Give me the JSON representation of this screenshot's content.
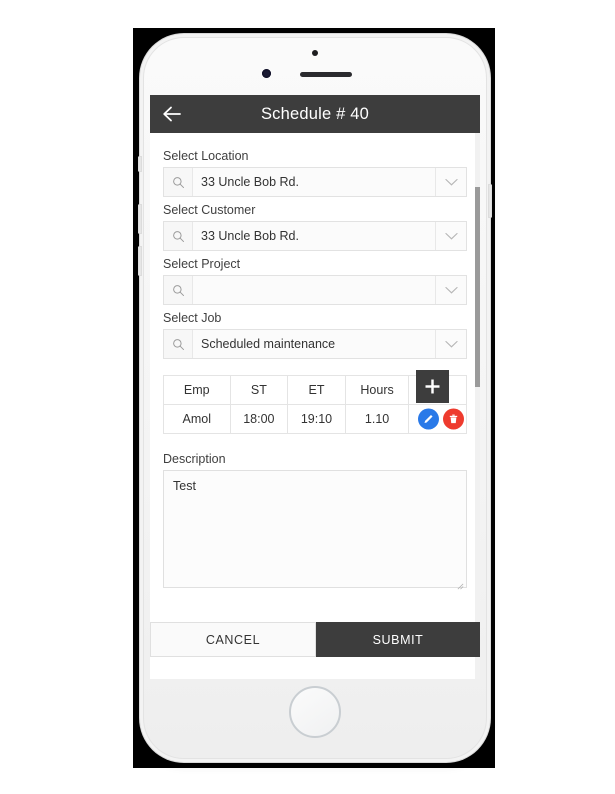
{
  "app": {
    "header": {
      "back_icon": "arrow-left-icon",
      "title": "Schedule # 40"
    }
  },
  "form": {
    "fields": [
      {
        "label": "Select Location",
        "value": "33 Uncle Bob Rd.",
        "placeholder": "",
        "search_icon": "search-icon",
        "caret_icon": "chevron-down-icon"
      },
      {
        "label": "Select Customer",
        "value": "33 Uncle Bob Rd.",
        "placeholder": "",
        "search_icon": "search-icon",
        "caret_icon": "chevron-down-icon"
      },
      {
        "label": "Select Project",
        "value": "",
        "placeholder": "",
        "search_icon": "search-icon",
        "caret_icon": "chevron-down-icon"
      },
      {
        "label": "Select Job",
        "value": "Scheduled maintenance",
        "placeholder": "",
        "search_icon": "search-icon",
        "caret_icon": "chevron-down-icon"
      }
    ]
  },
  "employee_table": {
    "columns": [
      "Emp",
      "ST",
      "ET",
      "Hours"
    ],
    "rows": [
      {
        "emp": "Amol",
        "st": "18:00",
        "et": "19:10",
        "hours": "1.10",
        "edit_icon": "pencil-icon",
        "delete_icon": "trash-icon"
      }
    ],
    "add_button": {
      "icon": "plus-icon",
      "label": "+"
    }
  },
  "description": {
    "label": "Description",
    "value": "Test",
    "placeholder": ""
  },
  "footer": {
    "cancel_label": "CANCEL",
    "submit_label": "SUBMIT"
  },
  "colors": {
    "header_bar": "#3d3d3d",
    "submit": "#3d3d3d",
    "edit": "#2979e8",
    "delete": "#ee3b2e",
    "add": "#3d3d3d"
  }
}
